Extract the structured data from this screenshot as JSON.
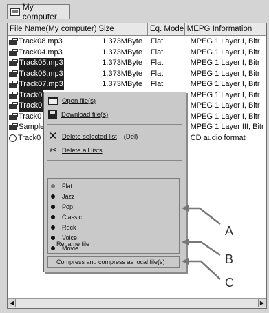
{
  "tab": {
    "label": "My computer"
  },
  "columns": {
    "name": "File Name(My computer)",
    "size": "Size",
    "eq": "Eq. Mode",
    "mpeg": "MEPG Information"
  },
  "files": [
    {
      "name": "Track08.mp3",
      "size": "1.373MByte",
      "eq": "Flat",
      "mpeg": "MPEG  1 Layer  I, Bitr",
      "selected": false,
      "icon": "music-file-icon"
    },
    {
      "name": "Track04.mp3",
      "size": "1.373MByte",
      "eq": "Flat",
      "mpeg": "MPEG  1 Layer  I, Bitr",
      "selected": false,
      "icon": "music-file-icon"
    },
    {
      "name": "Track05.mp3",
      "size": "1.373MByte",
      "eq": "Flat",
      "mpeg": "MPEG  1 Layer  I, Bitr",
      "selected": true,
      "icon": "music-file-icon"
    },
    {
      "name": "Track06.mp3",
      "size": "1.373MByte",
      "eq": "Flat",
      "mpeg": "MPEG  1 Layer  I, Bitr",
      "selected": true,
      "icon": "music-file-icon"
    },
    {
      "name": "Track07.mp3",
      "size": "1.373MByte",
      "eq": "Flat",
      "mpeg": "MPEG  1 Layer  I, Bitr",
      "selected": true,
      "icon": "music-file-icon"
    },
    {
      "name": "Track0",
      "size": "",
      "eq": "",
      "mpeg": "MPEG  1 Layer  I, Bitr",
      "selected": true,
      "icon": "music-file-icon"
    },
    {
      "name": "Track0",
      "size": "",
      "eq": "",
      "mpeg": "MPEG  1 Layer  I, Bitr",
      "selected": true,
      "icon": "music-file-icon"
    },
    {
      "name": "Track0",
      "size": "",
      "eq": "",
      "mpeg": "MPEG  1 Layer  I, Bitr",
      "selected": false,
      "icon": "music-file-icon"
    },
    {
      "name": "Sample",
      "size": "",
      "eq": "",
      "mpeg": "MPEG  1 Layer III, Bitr",
      "selected": false,
      "icon": "music-file-icon"
    },
    {
      "name": "Track0",
      "size": "",
      "eq": "",
      "mpeg": "CD audio format",
      "selected": false,
      "icon": "cd-audio-icon"
    }
  ],
  "menu": {
    "open": "Open file(s)",
    "download": "Download file(s)",
    "delete_selected": "Delete selected list",
    "delete_shortcut": "(Del)",
    "delete_all": "Delete all lists",
    "eq_modes": [
      "Flat",
      "Jazz",
      "Pop",
      "Classic",
      "Rock",
      "Voice",
      "Movie"
    ],
    "rename": "Rename file",
    "compress": "Compress and compress as local file(s)"
  },
  "callouts": {
    "a": "A",
    "b": "B",
    "c": "C"
  }
}
